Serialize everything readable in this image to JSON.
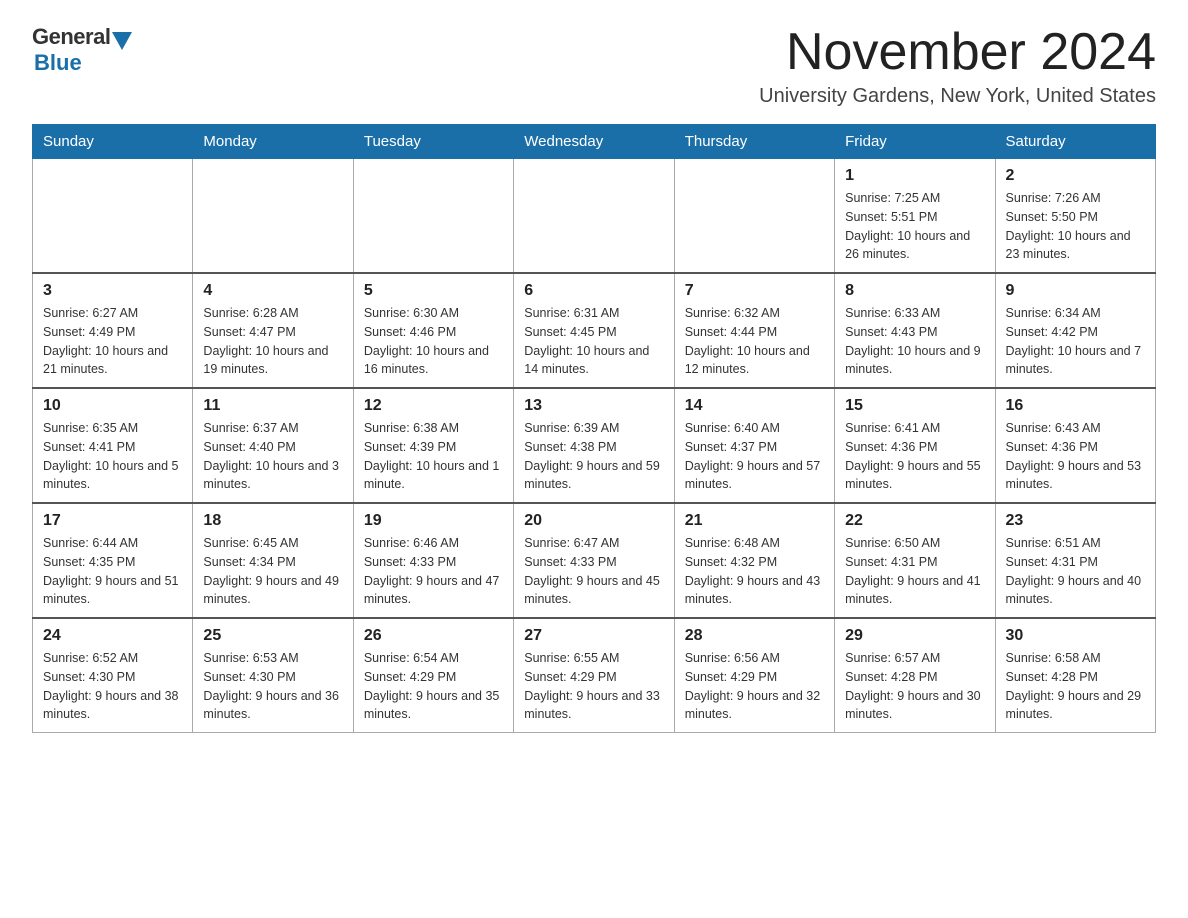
{
  "logo": {
    "text_general": "General",
    "text_blue": "Blue"
  },
  "title": "November 2024",
  "subtitle": "University Gardens, New York, United States",
  "weekdays": [
    "Sunday",
    "Monday",
    "Tuesday",
    "Wednesday",
    "Thursday",
    "Friday",
    "Saturday"
  ],
  "weeks": [
    [
      {
        "day": "",
        "info": ""
      },
      {
        "day": "",
        "info": ""
      },
      {
        "day": "",
        "info": ""
      },
      {
        "day": "",
        "info": ""
      },
      {
        "day": "",
        "info": ""
      },
      {
        "day": "1",
        "info": "Sunrise: 7:25 AM\nSunset: 5:51 PM\nDaylight: 10 hours and 26 minutes."
      },
      {
        "day": "2",
        "info": "Sunrise: 7:26 AM\nSunset: 5:50 PM\nDaylight: 10 hours and 23 minutes."
      }
    ],
    [
      {
        "day": "3",
        "info": "Sunrise: 6:27 AM\nSunset: 4:49 PM\nDaylight: 10 hours and 21 minutes."
      },
      {
        "day": "4",
        "info": "Sunrise: 6:28 AM\nSunset: 4:47 PM\nDaylight: 10 hours and 19 minutes."
      },
      {
        "day": "5",
        "info": "Sunrise: 6:30 AM\nSunset: 4:46 PM\nDaylight: 10 hours and 16 minutes."
      },
      {
        "day": "6",
        "info": "Sunrise: 6:31 AM\nSunset: 4:45 PM\nDaylight: 10 hours and 14 minutes."
      },
      {
        "day": "7",
        "info": "Sunrise: 6:32 AM\nSunset: 4:44 PM\nDaylight: 10 hours and 12 minutes."
      },
      {
        "day": "8",
        "info": "Sunrise: 6:33 AM\nSunset: 4:43 PM\nDaylight: 10 hours and 9 minutes."
      },
      {
        "day": "9",
        "info": "Sunrise: 6:34 AM\nSunset: 4:42 PM\nDaylight: 10 hours and 7 minutes."
      }
    ],
    [
      {
        "day": "10",
        "info": "Sunrise: 6:35 AM\nSunset: 4:41 PM\nDaylight: 10 hours and 5 minutes."
      },
      {
        "day": "11",
        "info": "Sunrise: 6:37 AM\nSunset: 4:40 PM\nDaylight: 10 hours and 3 minutes."
      },
      {
        "day": "12",
        "info": "Sunrise: 6:38 AM\nSunset: 4:39 PM\nDaylight: 10 hours and 1 minute."
      },
      {
        "day": "13",
        "info": "Sunrise: 6:39 AM\nSunset: 4:38 PM\nDaylight: 9 hours and 59 minutes."
      },
      {
        "day": "14",
        "info": "Sunrise: 6:40 AM\nSunset: 4:37 PM\nDaylight: 9 hours and 57 minutes."
      },
      {
        "day": "15",
        "info": "Sunrise: 6:41 AM\nSunset: 4:36 PM\nDaylight: 9 hours and 55 minutes."
      },
      {
        "day": "16",
        "info": "Sunrise: 6:43 AM\nSunset: 4:36 PM\nDaylight: 9 hours and 53 minutes."
      }
    ],
    [
      {
        "day": "17",
        "info": "Sunrise: 6:44 AM\nSunset: 4:35 PM\nDaylight: 9 hours and 51 minutes."
      },
      {
        "day": "18",
        "info": "Sunrise: 6:45 AM\nSunset: 4:34 PM\nDaylight: 9 hours and 49 minutes."
      },
      {
        "day": "19",
        "info": "Sunrise: 6:46 AM\nSunset: 4:33 PM\nDaylight: 9 hours and 47 minutes."
      },
      {
        "day": "20",
        "info": "Sunrise: 6:47 AM\nSunset: 4:33 PM\nDaylight: 9 hours and 45 minutes."
      },
      {
        "day": "21",
        "info": "Sunrise: 6:48 AM\nSunset: 4:32 PM\nDaylight: 9 hours and 43 minutes."
      },
      {
        "day": "22",
        "info": "Sunrise: 6:50 AM\nSunset: 4:31 PM\nDaylight: 9 hours and 41 minutes."
      },
      {
        "day": "23",
        "info": "Sunrise: 6:51 AM\nSunset: 4:31 PM\nDaylight: 9 hours and 40 minutes."
      }
    ],
    [
      {
        "day": "24",
        "info": "Sunrise: 6:52 AM\nSunset: 4:30 PM\nDaylight: 9 hours and 38 minutes."
      },
      {
        "day": "25",
        "info": "Sunrise: 6:53 AM\nSunset: 4:30 PM\nDaylight: 9 hours and 36 minutes."
      },
      {
        "day": "26",
        "info": "Sunrise: 6:54 AM\nSunset: 4:29 PM\nDaylight: 9 hours and 35 minutes."
      },
      {
        "day": "27",
        "info": "Sunrise: 6:55 AM\nSunset: 4:29 PM\nDaylight: 9 hours and 33 minutes."
      },
      {
        "day": "28",
        "info": "Sunrise: 6:56 AM\nSunset: 4:29 PM\nDaylight: 9 hours and 32 minutes."
      },
      {
        "day": "29",
        "info": "Sunrise: 6:57 AM\nSunset: 4:28 PM\nDaylight: 9 hours and 30 minutes."
      },
      {
        "day": "30",
        "info": "Sunrise: 6:58 AM\nSunset: 4:28 PM\nDaylight: 9 hours and 29 minutes."
      }
    ]
  ]
}
